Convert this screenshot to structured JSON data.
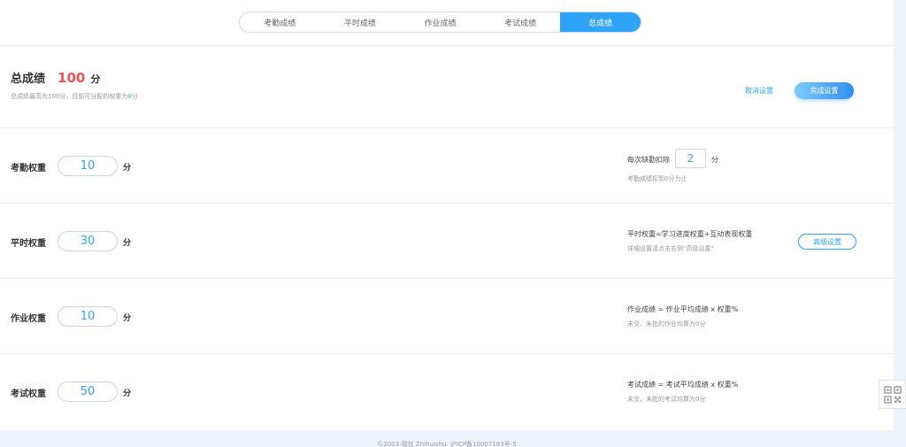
{
  "tabs": [
    {
      "label": "考勤成绩",
      "active": false
    },
    {
      "label": "平时成绩",
      "active": false
    },
    {
      "label": "作业成绩",
      "active": false
    },
    {
      "label": "考试成绩",
      "active": false
    },
    {
      "label": "总成绩",
      "active": true
    }
  ],
  "total": {
    "title": "总成绩",
    "value": "100",
    "unit": "分",
    "note_prefix": "总成绩最高为100分，目前可分配的权重为",
    "note_value": "0",
    "note_suffix": "分"
  },
  "actions": {
    "cancel_label": "取消设置",
    "finish_label": "完成设置"
  },
  "rows": {
    "attendance": {
      "label": "考勤权重",
      "value": "10",
      "unit": "分",
      "deduct_label": "每次缺勤扣除",
      "deduct_value": "2",
      "deduct_unit": "分",
      "note": "考勤成绩扣到0分为止"
    },
    "regular": {
      "label": "平时权重",
      "value": "30",
      "unit": "分",
      "text": "平时权重=学习进度权重+互动表现权重",
      "note": "详细设置请点击右侧\"高级设置\"",
      "advanced_label": "高级设置"
    },
    "homework": {
      "label": "作业权重",
      "value": "10",
      "unit": "分",
      "text": "作业成绩 = 作业平均成绩 x 权重%",
      "note": "未交、未批的作业均算为0分"
    },
    "exam": {
      "label": "考试权重",
      "value": "50",
      "unit": "分",
      "text": "考试成绩 = 考试平均成绩 x 权重%",
      "note": "未交、未批的考试均算为0分"
    }
  },
  "footer": "©2003-现在 Zhihuishu. 沪ICP备10007183号-5",
  "icons": {
    "qr": "qr-code-icon"
  },
  "colors": {
    "accent": "#2fa3f7",
    "total_value": "#f0545a"
  }
}
